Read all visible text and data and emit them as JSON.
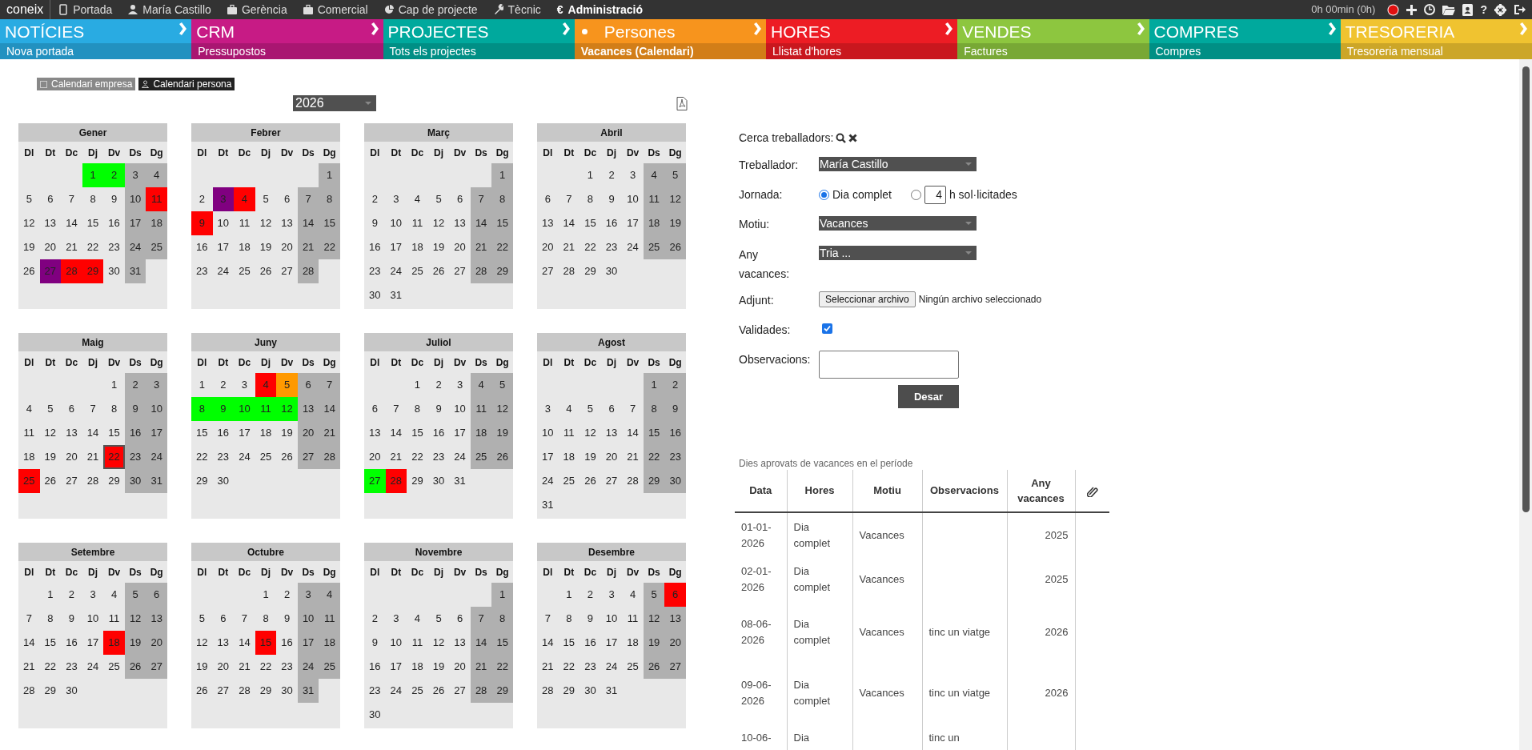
{
  "top_bar": {
    "logo": "coneix",
    "menu": [
      {
        "label": "Portada",
        "selected": false
      },
      {
        "label": "María Castillo",
        "selected": false
      },
      {
        "label": "Gerència",
        "selected": false
      },
      {
        "label": "Comercial",
        "selected": false
      },
      {
        "label": "Cap de projecte",
        "selected": false
      },
      {
        "label": "Tècnic",
        "selected": false
      },
      {
        "label": "Administració",
        "symbol": "€",
        "selected": true
      }
    ],
    "timer": "0h 00min (0h)",
    "help": "?"
  },
  "modules": [
    {
      "title": "NOTÍCIES",
      "subtitle": "Nova portada",
      "color": "#29abe2",
      "selected": false
    },
    {
      "title": "CRM",
      "subtitle": "Pressupostos",
      "color": "#c71b85",
      "selected": false
    },
    {
      "title": "PROJECTES",
      "subtitle": "Tots els projectes",
      "color": "#00a99d",
      "selected": false
    },
    {
      "title": "Persones",
      "subtitle": "Vacances (Calendari)",
      "color": "#f7941d",
      "selected": true
    },
    {
      "title": "HORES",
      "subtitle": "Llistat d'hores",
      "color": "#ed1c24",
      "selected": false
    },
    {
      "title": "VENDES",
      "subtitle": "Factures",
      "color": "#8dc63f",
      "selected": false
    },
    {
      "title": "COMPRES",
      "subtitle": "Compres",
      "color": "#00a99d",
      "selected": false
    },
    {
      "title": "TRESORERIA",
      "subtitle": "Tresoreria mensual",
      "color": "#f0c330",
      "selected": false
    }
  ],
  "calendar_tabs": [
    {
      "label": "Calendari empresa",
      "selected": false
    },
    {
      "label": "Calendari persona",
      "selected": true
    }
  ],
  "year_select": {
    "value": "2026"
  },
  "months": [
    {
      "name": "Gener",
      "weekdays": [
        "Dl",
        "Dt",
        "Dc",
        "Dj",
        "Dv",
        "Ds",
        "Dg"
      ],
      "weeks": [
        [
          {
            "day": "1",
            "color": "#00ff00"
          },
          {
            "day": "2",
            "color": "#00ff00"
          },
          "3",
          "4"
        ],
        [
          "5",
          "6",
          "7",
          "8",
          "9",
          "10",
          {
            "day": "11",
            "color": "#ff0000"
          }
        ],
        [
          "12",
          "13",
          "14",
          "15",
          "16",
          "17",
          "18"
        ],
        [
          "19",
          "20",
          "21",
          "22",
          "23",
          "24",
          "25"
        ],
        [
          "26",
          {
            "day": "27",
            "color": "#800080"
          },
          {
            "day": "28",
            "color": "#ff0000"
          },
          {
            "day": "29",
            "color": "#ff0000"
          },
          "30",
          "31"
        ]
      ]
    },
    {
      "name": "Febrer",
      "weekdays": [
        "Dl",
        "Dt",
        "Dc",
        "Dj",
        "Dv",
        "Ds",
        "Dg"
      ],
      "weeks": [
        [
          "1"
        ],
        [
          "2",
          {
            "day": "3",
            "color": "#800080"
          },
          {
            "day": "4",
            "color": "#ff0000"
          },
          "5",
          "6",
          "7",
          "8"
        ],
        [
          {
            "day": "9",
            "color": "#ff0000"
          },
          "10",
          "11",
          "12",
          "13",
          "14",
          "15"
        ],
        [
          "16",
          "17",
          "18",
          "19",
          "20",
          "21",
          "22"
        ],
        [
          "23",
          "24",
          "25",
          "26",
          "27",
          "28"
        ]
      ]
    },
    {
      "name": "Març",
      "weekdays": [
        "Dl",
        "Dt",
        "Dc",
        "Dj",
        "Dv",
        "Ds",
        "Dg"
      ],
      "weeks": [
        [
          "1"
        ],
        [
          "2",
          "3",
          "4",
          "5",
          "6",
          "7",
          "8"
        ],
        [
          "9",
          "10",
          "11",
          "12",
          "13",
          "14",
          "15"
        ],
        [
          "16",
          "17",
          "18",
          "19",
          "20",
          "21",
          "22"
        ],
        [
          "23",
          "24",
          "25",
          "26",
          "27",
          "28",
          "29"
        ],
        [
          "30",
          "31"
        ]
      ]
    },
    {
      "name": "Abril",
      "weekdays": [
        "Dl",
        "Dt",
        "Dc",
        "Dj",
        "Dv",
        "Ds",
        "Dg"
      ],
      "weeks": [
        [
          "1",
          "2",
          "3",
          "4",
          "5"
        ],
        [
          "6",
          "7",
          "8",
          "9",
          "10",
          "11",
          "12"
        ],
        [
          "13",
          "14",
          "15",
          "16",
          "17",
          "18",
          "19"
        ],
        [
          "20",
          "21",
          "22",
          "23",
          "24",
          "25",
          "26"
        ],
        [
          "27",
          "28",
          "29",
          "30"
        ]
      ]
    },
    {
      "name": "Maig",
      "weekdays": [
        "Dl",
        "Dt",
        "Dc",
        "Dj",
        "Dv",
        "Ds",
        "Dg"
      ],
      "weeks": [
        [
          "1",
          "2",
          "3"
        ],
        [
          "4",
          "5",
          "6",
          "7",
          "8",
          "9",
          "10"
        ],
        [
          "11",
          "12",
          "13",
          "14",
          "15",
          "16",
          "17"
        ],
        [
          "18",
          "19",
          "20",
          "21",
          {
            "day": "22",
            "color": "#ff0000",
            "today": true
          },
          "23",
          "24"
        ],
        [
          {
            "day": "25",
            "color": "#ff0000"
          },
          "26",
          "27",
          "28",
          "29",
          "30",
          "31"
        ]
      ]
    },
    {
      "name": "Juny",
      "weekdays": [
        "Dl",
        "Dt",
        "Dc",
        "Dj",
        "Dv",
        "Ds",
        "Dg"
      ],
      "weeks": [
        [
          "1",
          "2",
          "3",
          {
            "day": "4",
            "color": "#ff0000"
          },
          {
            "day": "5",
            "color": "#ff9900"
          },
          "6",
          "7"
        ],
        [
          {
            "day": "8",
            "color": "#00ff00"
          },
          {
            "day": "9",
            "color": "#00ff00"
          },
          {
            "day": "10",
            "color": "#00ff00"
          },
          {
            "day": "11",
            "color": "#00ff00"
          },
          {
            "day": "12",
            "color": "#00ff00"
          },
          "13",
          "14"
        ],
        [
          "15",
          "16",
          "17",
          "18",
          "19",
          "20",
          "21"
        ],
        [
          "22",
          "23",
          "24",
          "25",
          "26",
          "27",
          "28"
        ],
        [
          "29",
          "30"
        ]
      ]
    },
    {
      "name": "Juliol",
      "weekdays": [
        "Dl",
        "Dt",
        "Dc",
        "Dj",
        "Dv",
        "Ds",
        "Dg"
      ],
      "weeks": [
        [
          "1",
          "2",
          "3",
          "4",
          "5"
        ],
        [
          "6",
          "7",
          "8",
          "9",
          "10",
          "11",
          "12"
        ],
        [
          "13",
          "14",
          "15",
          "16",
          "17",
          "18",
          "19"
        ],
        [
          "20",
          "21",
          "22",
          "23",
          "24",
          "25",
          "26"
        ],
        [
          {
            "day": "27",
            "color": "#00ff00"
          },
          {
            "day": "28",
            "color": "#ff0000"
          },
          "29",
          "30",
          "31"
        ]
      ]
    },
    {
      "name": "Agost",
      "weekdays": [
        "Dl",
        "Dt",
        "Dc",
        "Dj",
        "Dv",
        "Ds",
        "Dg"
      ],
      "weeks": [
        [
          "1",
          "2"
        ],
        [
          "3",
          "4",
          "5",
          "6",
          "7",
          "8",
          "9"
        ],
        [
          "10",
          "11",
          "12",
          "13",
          "14",
          "15",
          "16"
        ],
        [
          "17",
          "18",
          "19",
          "20",
          "21",
          "22",
          "23"
        ],
        [
          "24",
          "25",
          "26",
          "27",
          "28",
          "29",
          "30"
        ],
        [
          "31"
        ]
      ]
    },
    {
      "name": "Setembre",
      "weekdays": [
        "Dl",
        "Dt",
        "Dc",
        "Dj",
        "Dv",
        "Ds",
        "Dg"
      ],
      "weeks": [
        [
          "1",
          "2",
          "3",
          "4",
          "5",
          "6"
        ],
        [
          "7",
          "8",
          "9",
          "10",
          "11",
          "12",
          "13"
        ],
        [
          "14",
          "15",
          "16",
          "17",
          {
            "day": "18",
            "color": "#ff0000"
          },
          "19",
          "20"
        ],
        [
          "21",
          "22",
          "23",
          "24",
          "25",
          "26",
          "27"
        ],
        [
          "28",
          "29",
          "30"
        ]
      ]
    },
    {
      "name": "Octubre",
      "weekdays": [
        "Dl",
        "Dt",
        "Dc",
        "Dj",
        "Dv",
        "Ds",
        "Dg"
      ],
      "weeks": [
        [
          "1",
          "2",
          "3",
          "4"
        ],
        [
          "5",
          "6",
          "7",
          "8",
          "9",
          "10",
          "11"
        ],
        [
          "12",
          "13",
          "14",
          {
            "day": "15",
            "color": "#ff0000"
          },
          "16",
          "17",
          "18"
        ],
        [
          "19",
          "20",
          "21",
          "22",
          "23",
          "24",
          "25"
        ],
        [
          "26",
          "27",
          "28",
          "29",
          "30",
          "31"
        ]
      ]
    },
    {
      "name": "Novembre",
      "weekdays": [
        "Dl",
        "Dt",
        "Dc",
        "Dj",
        "Dv",
        "Ds",
        "Dg"
      ],
      "weeks": [
        [
          "1"
        ],
        [
          "2",
          "3",
          "4",
          "5",
          "6",
          "7",
          "8"
        ],
        [
          "9",
          "10",
          "11",
          "12",
          "13",
          "14",
          "15"
        ],
        [
          "16",
          "17",
          "18",
          "19",
          "20",
          "21",
          "22"
        ],
        [
          "23",
          "24",
          "25",
          "26",
          "27",
          "28",
          "29"
        ],
        [
          "30"
        ]
      ]
    },
    {
      "name": "Desembre",
      "weekdays": [
        "Dl",
        "Dt",
        "Dc",
        "Dj",
        "Dv",
        "Ds",
        "Dg"
      ],
      "weeks": [
        [
          "1",
          "2",
          "3",
          "4",
          "5",
          {
            "day": "6",
            "color": "#ff0000"
          }
        ],
        [
          "7",
          "8",
          "9",
          "10",
          "11",
          "12",
          "13"
        ],
        [
          "14",
          "15",
          "16",
          "17",
          "18",
          "19",
          "20"
        ],
        [
          "21",
          "22",
          "23",
          "24",
          "25",
          "26",
          "27"
        ],
        [
          "28",
          "29",
          "30",
          "31"
        ]
      ]
    }
  ],
  "form": {
    "search_label": "Cerca treballadors:",
    "worker": {
      "label": "Treballador:",
      "value": "María Castillo"
    },
    "shift": {
      "label": "Jornada:",
      "options": [
        {
          "label": "Dia complet",
          "selected": true
        },
        {
          "label": "h sol·licitades",
          "hours": "4",
          "selected": false
        }
      ]
    },
    "reason": {
      "label": "Motiu:",
      "value": "Vacances"
    },
    "year": {
      "label": "Any vacances:",
      "value": "Tria ..."
    },
    "attachment": {
      "label": "Adjunt:",
      "button": "Seleccionar archivo",
      "status": "Ningún archivo seleccionado"
    },
    "validated": {
      "label": "Validades:",
      "checked": true
    },
    "notes": {
      "label": "Observacions:"
    },
    "save": "Desar"
  },
  "table": {
    "caption": "Dies aprovats de vacances en el període",
    "columns": [
      "Data",
      "Hores",
      "Motiu",
      "Observacions",
      "Any vacances"
    ],
    "rows": [
      {
        "date": "01-01-2026",
        "hours": "Dia complet",
        "reason": "Vacances",
        "year": "2025"
      },
      {
        "date": "02-01-2026",
        "hours": "Dia complet",
        "reason": "Vacances",
        "year": "2025"
      },
      {
        "date": "08-06-2026",
        "hours": "Dia complet",
        "reason": "Vacances",
        "notes": "tinc un viatge",
        "year": "2026"
      },
      {
        "date": "09-06-2026",
        "hours": "Dia complet",
        "reason": "Vacances",
        "notes": "tinc un viatge",
        "year": "2026"
      },
      {
        "date": "10-06-",
        "hours": "Dia",
        "notes": "tinc un"
      }
    ]
  }
}
